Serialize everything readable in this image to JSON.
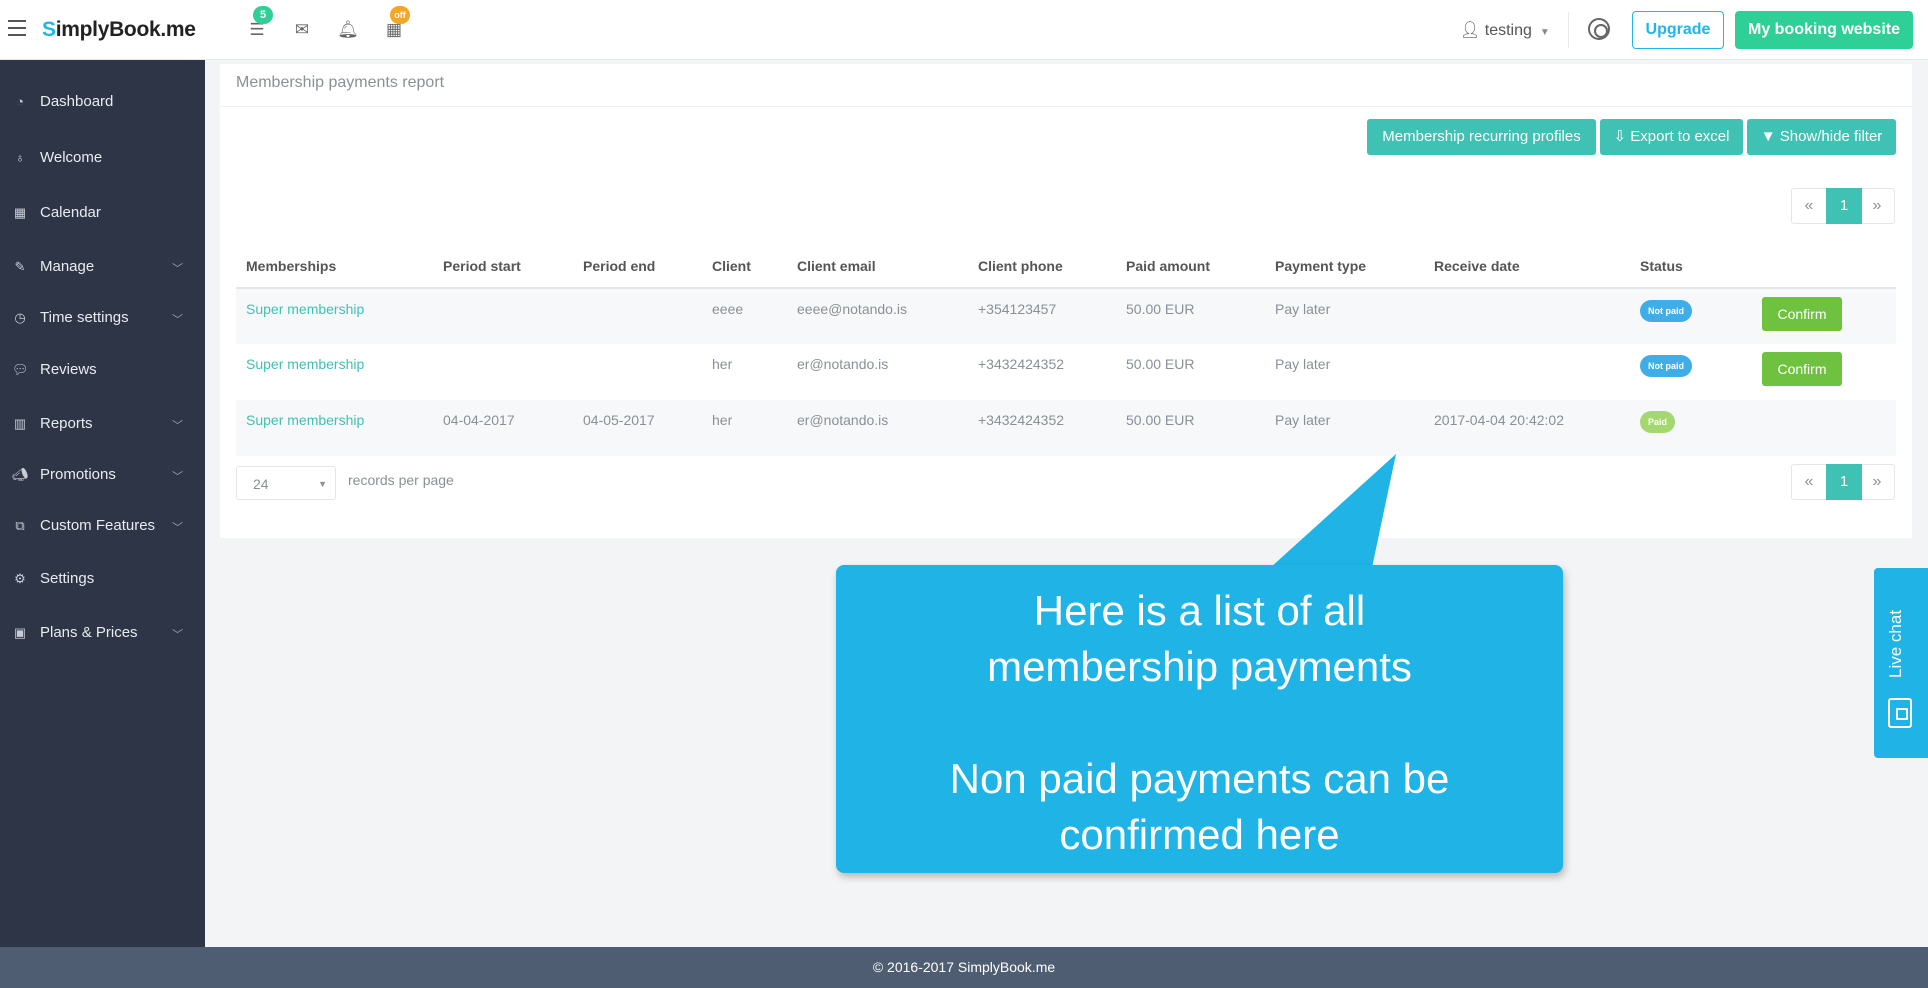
{
  "topbar": {
    "brand_s": "S",
    "brand_rest": "implyBook",
    "brand_suffix": ".me",
    "notifications_badge": "5",
    "calendar_badge": "off",
    "user": "testing",
    "upgrade_label": "Upgrade",
    "booking_label": "My booking website"
  },
  "sidebar": {
    "items": [
      {
        "label": "Dashboard",
        "icon": "dashboard-icon",
        "chevron": false
      },
      {
        "label": "Welcome",
        "icon": "lightbulb-icon",
        "chevron": false
      },
      {
        "label": "Calendar",
        "icon": "calendar-icon",
        "chevron": false
      },
      {
        "label": "Manage",
        "icon": "pencil-icon",
        "chevron": true
      },
      {
        "label": "Time settings",
        "icon": "clock-icon",
        "chevron": true
      },
      {
        "label": "Reviews",
        "icon": "comments-icon",
        "chevron": false
      },
      {
        "label": "Reports",
        "icon": "bar-chart-icon",
        "chevron": true
      },
      {
        "label": "Promotions",
        "icon": "megaphone-icon",
        "chevron": true
      },
      {
        "label": "Custom Features",
        "icon": "puzzle-icon",
        "chevron": true
      },
      {
        "label": "Settings",
        "icon": "gears-icon",
        "chevron": false
      },
      {
        "label": "Plans & Prices",
        "icon": "money-icon",
        "chevron": true
      }
    ]
  },
  "panel": {
    "title": "Membership payments report",
    "buttons": {
      "recurring": "Membership recurring profiles",
      "export": "Export to excel",
      "filter": "Show/hide filter"
    },
    "pager": {
      "prev": "«",
      "current": "1",
      "next": "»"
    },
    "columns": [
      "Memberships",
      "Period start",
      "Period end",
      "Client",
      "Client email",
      "Client phone",
      "Paid amount",
      "Payment type",
      "Receive date",
      "Status"
    ],
    "rows": [
      {
        "membership": "Super membership",
        "start": "",
        "end": "",
        "client": "eeee",
        "email": "eeee@notando.is",
        "phone": "+354123457",
        "amount": "50.00 EUR",
        "type": "Pay later",
        "receive": "",
        "status": "Not paid",
        "action": "Confirm"
      },
      {
        "membership": "Super membership",
        "start": "",
        "end": "",
        "client": "her",
        "email": "er@notando.is",
        "phone": "+3432424352",
        "amount": "50.00 EUR",
        "type": "Pay later",
        "receive": "",
        "status": "Not paid",
        "action": "Confirm"
      },
      {
        "membership": "Super membership",
        "start": "04-04-2017",
        "end": "04-05-2017",
        "client": "her",
        "email": "er@notando.is",
        "phone": "+3432424352",
        "amount": "50.00 EUR",
        "type": "Pay later",
        "receive": "2017-04-04 20:42:02",
        "status": "Paid",
        "action": ""
      }
    ],
    "records_per_page": "24",
    "records_label": "records per page"
  },
  "callout": {
    "line1": "Here is a list of all",
    "line2": "membership payments",
    "line3": "Non paid payments can be",
    "line4": "confirmed here"
  },
  "livechat": {
    "label": "Live chat"
  },
  "footer": {
    "text": "© 2016-2017 SimplyBook.me"
  },
  "colors": {
    "teal": "#3fc1b4",
    "blue": "#1fb3e6",
    "green": "#2fd097",
    "confirm": "#6fc240",
    "sidebar": "#2d3547"
  }
}
